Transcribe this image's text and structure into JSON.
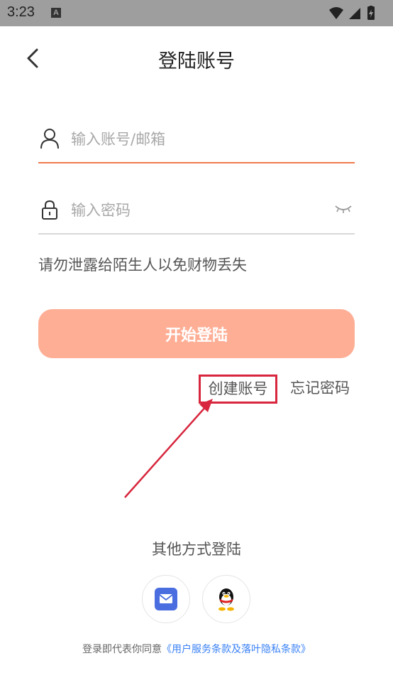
{
  "status_bar": {
    "time": "3:23",
    "notification_icon": "a-icon",
    "icons": [
      "wifi-icon",
      "signal-icon",
      "battery-icon"
    ]
  },
  "header": {
    "back_icon": "chevron-left-icon",
    "title": "登陆账号"
  },
  "form": {
    "account": {
      "icon": "user-icon",
      "placeholder": "输入账号/邮箱",
      "value": ""
    },
    "password": {
      "icon": "lock-icon",
      "placeholder": "输入密码",
      "value": "",
      "toggle_icon": "eye-closed-icon"
    },
    "warning": "请勿泄露给陌生人以免财物丢失",
    "submit_label": "开始登陆",
    "create_account_label": "创建账号",
    "forgot_password_label": "忘记密码"
  },
  "other_login": {
    "title": "其他方式登陆",
    "providers": [
      {
        "name": "mail-icon"
      },
      {
        "name": "qq-icon"
      }
    ]
  },
  "agreement": {
    "prefix": "登录即代表你同意",
    "link": "《用户服务条款及落叶隐私条款》"
  },
  "colors": {
    "accent": "#f07a4e",
    "button": "#feae95",
    "annotation": "#d7263d",
    "link": "#3b82f6",
    "status_bar": "#9e9e9e"
  }
}
